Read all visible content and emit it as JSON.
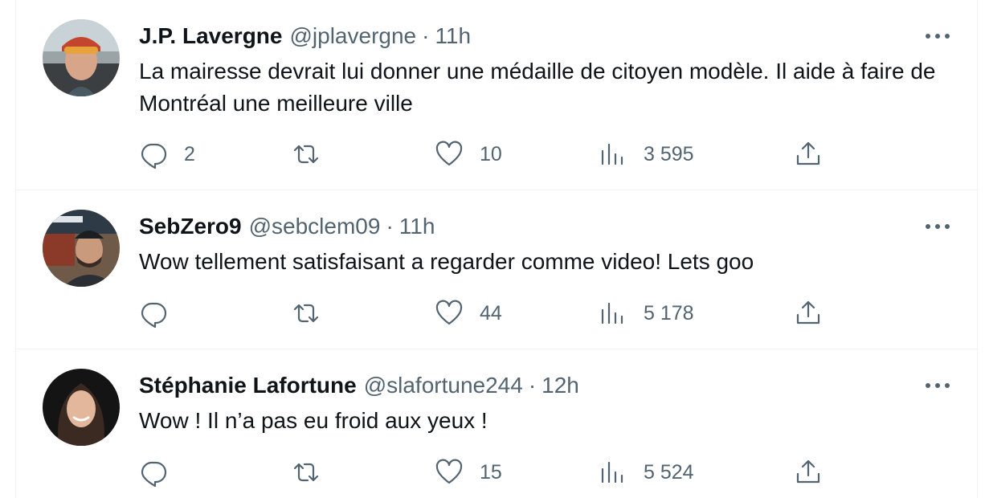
{
  "tweets": [
    {
      "name": "J.P. Lavergne",
      "handle": "@jplavergne",
      "separator": "·",
      "time": "11h",
      "text": "La mairesse devrait lui donner une médaille de citoyen modèle. Il aide à faire de Montréal une meilleure ville",
      "replies": "2",
      "retweets": "",
      "likes": "10",
      "views": "3 595"
    },
    {
      "name": "SebZero9",
      "handle": "@sebclem09",
      "separator": "·",
      "time": "11h",
      "text": "Wow tellement satisfaisant a regarder comme video! Lets goo",
      "replies": "",
      "retweets": "",
      "likes": "44",
      "views": "5 178"
    },
    {
      "name": "Stéphanie Lafortune",
      "handle": "@slafortune244",
      "separator": "·",
      "time": "12h",
      "text": "Wow ! Il n’a pas eu froid aux yeux !",
      "replies": "",
      "retweets": "",
      "likes": "15",
      "views": "5 524"
    }
  ],
  "icons": {
    "more": "more-horizontal-icon",
    "reply": "reply-icon",
    "retweet": "retweet-icon",
    "like": "heart-icon",
    "views": "views-chart-icon",
    "share": "share-icon"
  },
  "colors": {
    "text_primary": "#0f1419",
    "text_secondary": "#536471",
    "divider": "#eff3f4"
  }
}
